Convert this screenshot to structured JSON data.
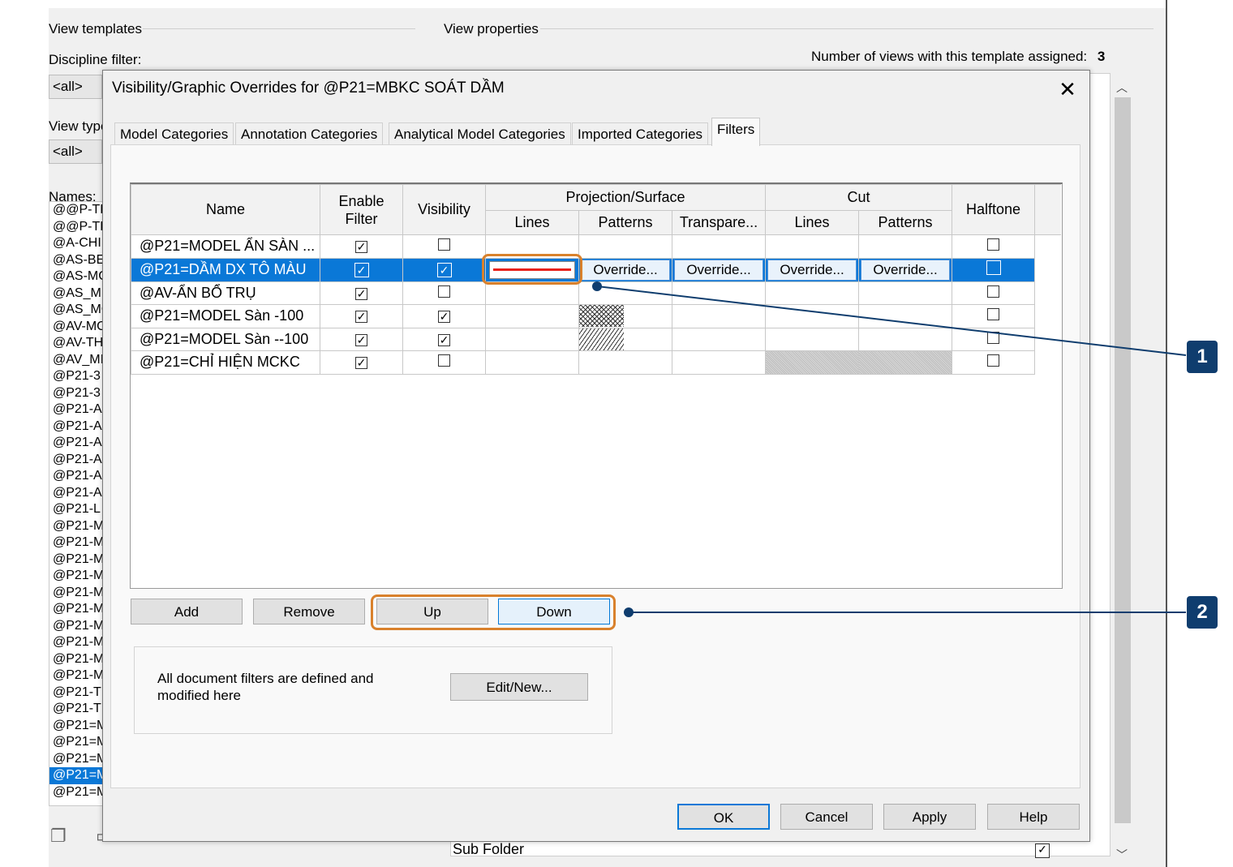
{
  "background": {
    "view_templates_label": "View templates",
    "discipline_filter_label": "Discipline filter:",
    "discipline_filter_value": "<all>",
    "view_type_label": "View type",
    "view_type_value": "<all>",
    "names_label": "Names:",
    "view_properties_label": "View properties",
    "views_assigned_label": "Number of views with this template assigned:",
    "views_assigned_value": "3",
    "sub_folder_label": "Sub Folder",
    "names": [
      "@@P-TH",
      "@@P-TK",
      "@A-CHI",
      "@AS-BE",
      "@AS-MC",
      "@AS_MI",
      "@AS_MC",
      "@AV-MC",
      "@AV-TH",
      "@AV_MI",
      "@P21-3",
      "@P21-3",
      "@P21-A",
      "@P21-A",
      "@P21-A",
      "@P21-A",
      "@P21-A",
      "@P21-A",
      "@P21-L",
      "@P21-M",
      "@P21-M",
      "@P21-M",
      "@P21-M",
      "@P21-M",
      "@P21-M",
      "@P21-M",
      "@P21-M",
      "@P21-M",
      "@P21-M",
      "@P21-T",
      "@P21-T",
      "@P21=M",
      "@P21=M",
      "@P21=M",
      "@P21=M",
      "@P21=M"
    ],
    "selected_name_index": 34
  },
  "dialog": {
    "title": "Visibility/Graphic Overrides for @P21=MBKC SOÁT DẦM",
    "close_glyph": "✕",
    "tabs": [
      {
        "label": "Model Categories",
        "active": false
      },
      {
        "label": "Annotation Categories",
        "active": false
      },
      {
        "label": "Analytical Model Categories",
        "active": false
      },
      {
        "label": "Imported Categories",
        "active": false
      },
      {
        "label": "Filters",
        "active": true
      }
    ],
    "table": {
      "headers": {
        "name": "Name",
        "enable_filter": "Enable Filter",
        "visibility": "Visibility",
        "projection_surface": "Projection/Surface",
        "cut": "Cut",
        "halftone": "Halftone",
        "proj_lines": "Lines",
        "proj_patterns": "Patterns",
        "proj_transparency": "Transpare...",
        "cut_lines": "Lines",
        "cut_patterns": "Patterns"
      },
      "override_label": "Override...",
      "check_glyph": "✓",
      "rows": [
        {
          "name": "@P21=MODEL ẨN SÀN ...",
          "enable": true,
          "visible": false,
          "halftone": false,
          "selected": false,
          "proj_lines": "",
          "proj_patterns": "",
          "cut_lines": "",
          "cut_patterns": ""
        },
        {
          "name": "@P21=DẦM DX TÔ MÀU",
          "enable": true,
          "visible": true,
          "halftone": false,
          "selected": true,
          "proj_lines": "red-line",
          "proj_patterns": "override",
          "cut_lines": "override",
          "cut_patterns": "override"
        },
        {
          "name": "@AV-ẨN BỔ TRỤ",
          "enable": true,
          "visible": false,
          "halftone": false,
          "selected": false,
          "proj_lines": "",
          "proj_patterns": "",
          "cut_lines": "",
          "cut_patterns": ""
        },
        {
          "name": "@P21=MODEL Sàn -100",
          "enable": true,
          "visible": true,
          "halftone": false,
          "selected": false,
          "proj_lines": "",
          "proj_patterns": "crosshatch",
          "cut_lines": "",
          "cut_patterns": ""
        },
        {
          "name": "@P21=MODEL Sàn --100",
          "enable": true,
          "visible": true,
          "halftone": false,
          "selected": false,
          "proj_lines": "",
          "proj_patterns": "diagonal",
          "cut_lines": "",
          "cut_patterns": ""
        },
        {
          "name": "@P21=CHỈ HIỆN MCKC",
          "enable": true,
          "visible": false,
          "halftone": false,
          "selected": false,
          "proj_lines": "",
          "proj_patterns": "",
          "cut_lines": "gray",
          "cut_patterns": "gray"
        }
      ]
    },
    "buttons": {
      "add": "Add",
      "remove": "Remove",
      "up": "Up",
      "down": "Down",
      "edit_new": "Edit/New...",
      "ok": "OK",
      "cancel": "Cancel",
      "apply": "Apply",
      "help": "Help"
    },
    "info_text": "All document filters are defined and modified here"
  },
  "callouts": [
    {
      "number": "1"
    },
    {
      "number": "2"
    }
  ],
  "colors": {
    "selection": "#0a78d7",
    "callout_ring": "#d9812c",
    "callout_badge": "#0f3d6e",
    "line_override": "#e8221a"
  }
}
